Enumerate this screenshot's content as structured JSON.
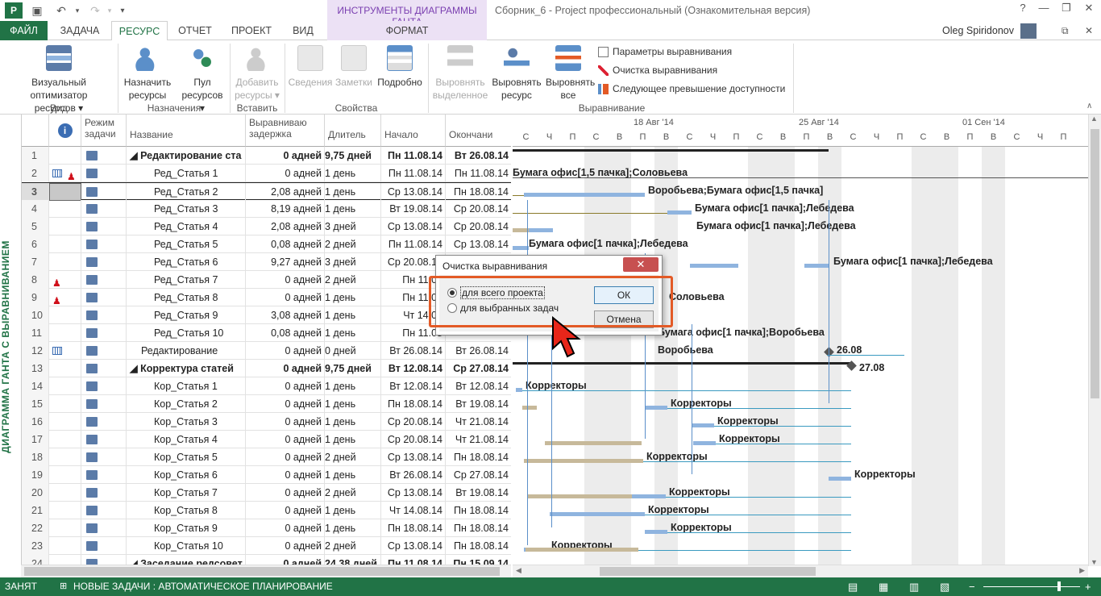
{
  "window": {
    "title": "Сборник_6 - Project профессиональный (Ознакомительная версия)",
    "context_tab_group": "ИНСТРУМЕНТЫ ДИАГРАММЫ ГАНТА",
    "user": "Oleg Spiridonov",
    "minimize": "—",
    "restore": "❐",
    "close": "✕",
    "help": "?"
  },
  "tabs": [
    "ФАЙЛ",
    "ЗАДАЧА",
    "РЕСУРС",
    "ОТЧЕТ",
    "ПРОЕКТ",
    "ВИД",
    "ФОРМАТ"
  ],
  "ribbon": {
    "visual_optimizer": "Визуальный оптимизатор ресурсов ▾",
    "group_view": "Вид",
    "assign": "Назначить ресурсы",
    "pool": "Пул ресурсов ▾",
    "group_assign": "Назначения",
    "add": "Добавить ресурсы ▾",
    "group_insert": "Вставить",
    "info": "Сведения",
    "notes": "Заметки",
    "details": "Подробно",
    "group_props": "Свойства",
    "level_sel": "Выровнять выделенное",
    "level_res": "Выровнять ресурс",
    "level_all": "Выровнять все",
    "level_opts": "Параметры выравнивания",
    "clear_level": "Очистка выравнивания",
    "next_over": "Следующее превышение доступности",
    "group_level": "Выравнивание"
  },
  "sidebar_label": "ДИАГРАММА ГАНТА С ВЫРАВНИВАНИЕМ",
  "columns": {
    "mode": "Режим задачи",
    "name": "Название",
    "delay": "Выравниваю задержка",
    "dur": "Длитель",
    "start": "Начало",
    "finish": "Окончани"
  },
  "rows": [
    {
      "n": "1",
      "name": "◢ Редактирование ста",
      "delay": "0 адней",
      "dur": "9,75 дней",
      "start": "Пн 11.08.14",
      "finish": "Вт 26.08.14",
      "bold": true,
      "indent": 0
    },
    {
      "n": "2",
      "name": "Ред_Статья 1",
      "delay": "0 адней",
      "dur": "1 день",
      "start": "Пн 11.08.14",
      "finish": "Пн 11.08.14",
      "ind": "cal-person"
    },
    {
      "n": "3",
      "name": "Ред_Статья 2",
      "delay": "2,08 адней",
      "dur": "1 день",
      "start": "Ср 13.08.14",
      "finish": "Пн 18.08.14",
      "sel": true
    },
    {
      "n": "4",
      "name": "Ред_Статья 3",
      "delay": "8,19 адней",
      "dur": "1 день",
      "start": "Вт 19.08.14",
      "finish": "Ср 20.08.14"
    },
    {
      "n": "5",
      "name": "Ред_Статья 4",
      "delay": "2,08 адней",
      "dur": "3 дней",
      "start": "Ср 13.08.14",
      "finish": "Ср 20.08.14"
    },
    {
      "n": "6",
      "name": "Ред_Статья 5",
      "delay": "0,08 адней",
      "dur": "2 дней",
      "start": "Пн 11.08.14",
      "finish": "Ср 13.08.14"
    },
    {
      "n": "7",
      "name": "Ред_Статья 6",
      "delay": "9,27 адней",
      "dur": "3 дней",
      "start": "Ср 20.08.14",
      "finish": ""
    },
    {
      "n": "8",
      "name": "Ред_Статья 7",
      "delay": "0 адней",
      "dur": "2 дней",
      "start": "Пн 11.08",
      "finish": "",
      "ind": "person"
    },
    {
      "n": "9",
      "name": "Ред_Статья 8",
      "delay": "0 адней",
      "dur": "1 день",
      "start": "Пн 11.08",
      "finish": "",
      "ind": "person"
    },
    {
      "n": "10",
      "name": "Ред_Статья 9",
      "delay": "3,08 адней",
      "dur": "1 день",
      "start": "Чт 14.08",
      "finish": ""
    },
    {
      "n": "11",
      "name": "Ред_Статья 10",
      "delay": "0,08 адней",
      "dur": "1 день",
      "start": "Пн 11.08",
      "finish": ""
    },
    {
      "n": "12",
      "name": "Редактирование",
      "delay": "0 адней",
      "dur": "0 дней",
      "start": "Вт 26.08.14",
      "finish": "Вт 26.08.14",
      "ind": "cal",
      "indent": 1
    },
    {
      "n": "13",
      "name": "◢ Корректура статей",
      "delay": "0 адней",
      "dur": "9,75 дней",
      "start": "Вт 12.08.14",
      "finish": "Ср 27.08.14",
      "bold": true,
      "indent": 0
    },
    {
      "n": "14",
      "name": "Кор_Статья 1",
      "delay": "0 адней",
      "dur": "1 день",
      "start": "Вт 12.08.14",
      "finish": "Вт 12.08.14"
    },
    {
      "n": "15",
      "name": "Кор_Статья 2",
      "delay": "0 адней",
      "dur": "1 день",
      "start": "Пн 18.08.14",
      "finish": "Вт 19.08.14"
    },
    {
      "n": "16",
      "name": "Кор_Статья 3",
      "delay": "0 адней",
      "dur": "1 день",
      "start": "Ср 20.08.14",
      "finish": "Чт 21.08.14"
    },
    {
      "n": "17",
      "name": "Кор_Статья 4",
      "delay": "0 адней",
      "dur": "1 день",
      "start": "Ср 20.08.14",
      "finish": "Чт 21.08.14"
    },
    {
      "n": "18",
      "name": "Кор_Статья 5",
      "delay": "0 адней",
      "dur": "2 дней",
      "start": "Ср 13.08.14",
      "finish": "Пн 18.08.14"
    },
    {
      "n": "19",
      "name": "Кор_Статья 6",
      "delay": "0 адней",
      "dur": "1 день",
      "start": "Вт 26.08.14",
      "finish": "Ср 27.08.14"
    },
    {
      "n": "20",
      "name": "Кор_Статья 7",
      "delay": "0 адней",
      "dur": "2 дней",
      "start": "Ср 13.08.14",
      "finish": "Вт 19.08.14"
    },
    {
      "n": "21",
      "name": "Кор_Статья 8",
      "delay": "0 адней",
      "dur": "1 день",
      "start": "Чт 14.08.14",
      "finish": "Пн 18.08.14"
    },
    {
      "n": "22",
      "name": "Кор_Статья 9",
      "delay": "0 адней",
      "dur": "1 день",
      "start": "Пн 18.08.14",
      "finish": "Пн 18.08.14"
    },
    {
      "n": "23",
      "name": "Кор_Статья 10",
      "delay": "0 адней",
      "dur": "2 дней",
      "start": "Ср 13.08.14",
      "finish": "Пн 18.08.14"
    },
    {
      "n": "24",
      "name": "◢ Заседание редсовет",
      "delay": "0 адней",
      "dur": "24,38 дней",
      "start": "Пн 11.08.14",
      "finish": "Пн 15.09.14",
      "bold": true,
      "indent": 0
    }
  ],
  "timeline": {
    "weeks": [
      "18 Авг '14",
      "25 Авг '14",
      "01 Сен '14"
    ],
    "days": [
      "С",
      "Ч",
      "П",
      "С",
      "В",
      "П",
      "В",
      "С",
      "Ч",
      "П",
      "С",
      "В",
      "П",
      "В",
      "С",
      "Ч",
      "П",
      "С",
      "В",
      "П",
      "В",
      "С",
      "Ч",
      "П"
    ]
  },
  "gantt_labels": [
    "Бумага офис[1,5 пачка];Соловьева",
    "Воробьева;Бумага офис[1,5 пачка]",
    "Бумага офис[1 пачка];Лебедева",
    "Бумага офис[1 пачка];Лебедева",
    "Бумага офис[1 пачка];Лебедева",
    "Бумага офис[1 пачка];Лебедева",
    "Соловьева",
    "Бумага офис[1 пачка];Воробьева",
    "Воробьева",
    "26.08",
    "27.08",
    "Корректоры",
    "Корректоры",
    "Корректоры",
    "Корректоры",
    "Корректоры",
    "Корректоры",
    "Корректоры",
    "Корректоры",
    "Корректоры",
    "Корректоры"
  ],
  "dialog": {
    "title": "Очистка выравнивания",
    "opt_all": "для всего проекта",
    "opt_sel": "для выбранных задач",
    "ok": "ОК",
    "cancel": "Отмена",
    "selected": "all"
  },
  "status": {
    "ready": "ЗАНЯТ",
    "mode": "НОВЫЕ ЗАДАЧИ : АВТОМАТИЧЕСКОЕ ПЛАНИРОВАНИЕ"
  },
  "colors": {
    "accent": "#217346",
    "bar": "#8fb4df",
    "preleveled": "#c7b99a",
    "highlight": "#e35a26"
  }
}
